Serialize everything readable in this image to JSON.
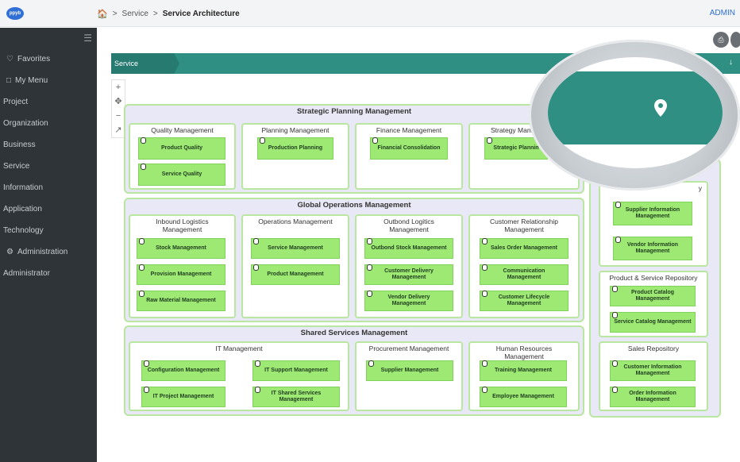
{
  "header": {
    "breadcrumb": [
      "Service",
      "Service Architecture"
    ],
    "user": "ADMIN",
    "logo_text": "ppyb"
  },
  "sidebar": {
    "items": [
      {
        "label": "Favorites",
        "icon": "heart-icon"
      },
      {
        "label": "My Menu",
        "icon": "bookmark-icon"
      },
      {
        "label": "Project"
      },
      {
        "label": "Organization"
      },
      {
        "label": "Business"
      },
      {
        "label": "Service"
      },
      {
        "label": "Information"
      },
      {
        "label": "Application"
      },
      {
        "label": "Technology"
      },
      {
        "label": "Administration",
        "icon": "gears-icon"
      },
      {
        "label": "Administrator"
      }
    ]
  },
  "page": {
    "title": "Service Architecture"
  },
  "groups": {
    "strategic": {
      "title": "Strategic Planning Management",
      "caps": [
        {
          "title": "Quality Management",
          "apps": [
            "Product Quality",
            "Service Quality"
          ]
        },
        {
          "title": "Planning Management",
          "apps": [
            "Production Planning"
          ]
        },
        {
          "title": "Finance Management",
          "apps": [
            "Financial Consolidation"
          ]
        },
        {
          "title": "Strategy Mana",
          "apps": [
            "Strategic Plannin"
          ]
        }
      ]
    },
    "global": {
      "title": "Global Operations Management",
      "caps": [
        {
          "title": "Inbound Logistics Management",
          "apps": [
            "Stock Management",
            "Provision Management",
            "Raw Material Management"
          ]
        },
        {
          "title": "Operations Management",
          "apps": [
            "Service Management",
            "Product Management"
          ]
        },
        {
          "title": "Outbond Logitics Management",
          "apps": [
            "Outbond Stock Management",
            "Customer Delivery Management",
            "Vendor Delivery Management"
          ]
        },
        {
          "title": "Customer Relationship Management",
          "apps": [
            "Sales Order Management",
            "Communication Management",
            "Customer Lifecycle Management"
          ]
        }
      ]
    },
    "shared": {
      "title": "Shared Services Management",
      "caps": [
        {
          "title": "IT Management",
          "apps": [
            "Configuration Management",
            "IT Support Management",
            "IT Project Management",
            "IT Shared Services Management"
          ]
        },
        {
          "title": "Procurement Management",
          "apps": [
            "Supplier Management"
          ]
        },
        {
          "title": "Human Resources Management",
          "apps": [
            "Training Management",
            "Employee Management"
          ]
        }
      ]
    }
  },
  "repos": {
    "first": {
      "title": "y",
      "apps": [
        "Supplier Information Management",
        "Vendor Information Management"
      ]
    },
    "product": {
      "title": "Product & Service Repository",
      "apps": [
        "Product Catalog Management",
        "Service Catalog Management"
      ]
    },
    "sales": {
      "title": "Sales Repository",
      "apps": [
        "Customer Information Management",
        "Order Information Management"
      ]
    }
  },
  "colors": {
    "accent": "#2f8f83",
    "app_fill": "#9ee874",
    "group_border": "#b9e6a0",
    "sidebar": "#2f3439"
  }
}
